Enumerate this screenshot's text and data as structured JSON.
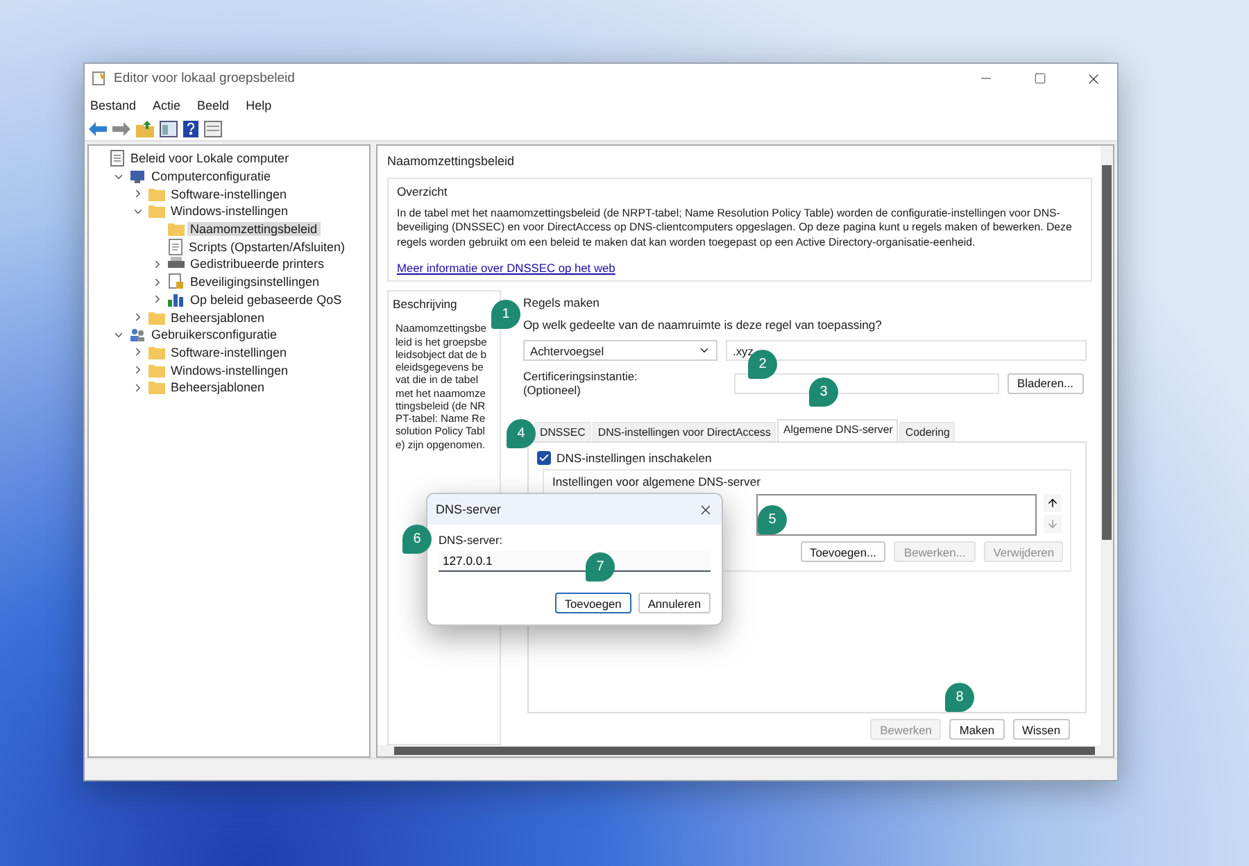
{
  "window": {
    "title": "Editor voor lokaal groepsbeleid"
  },
  "menu": [
    "Bestand",
    "Actie",
    "Beeld",
    "Help"
  ],
  "tree": [
    {
      "label": "Beleid voor Lokale computer",
      "kind": "policy",
      "selected": false,
      "children": [
        {
          "label": "Computerconfiguratie",
          "kind": "computer",
          "expanded": true,
          "selected": false,
          "children": [
            {
              "label": "Software-instellingen",
              "kind": "folder",
              "expanded": false,
              "selected": false
            },
            {
              "label": "Windows-instellingen",
              "kind": "folder",
              "expanded": true,
              "selected": false,
              "children": [
                {
                  "label": "Naamomzettingsbeleid",
                  "kind": "folder",
                  "selected": true
                },
                {
                  "label": "Scripts (Opstarten/Afsluiten)",
                  "kind": "script",
                  "selected": false
                },
                {
                  "label": "Gedistribueerde printers",
                  "kind": "printer",
                  "expanded": false,
                  "selected": false
                },
                {
                  "label": "Beveiligingsinstellingen",
                  "kind": "security",
                  "expanded": false,
                  "selected": false
                },
                {
                  "label": "Op beleid gebaseerde QoS",
                  "kind": "chart",
                  "expanded": false,
                  "selected": false
                }
              ]
            },
            {
              "label": "Beheersjablonen",
              "kind": "folder",
              "expanded": false,
              "selected": false
            }
          ]
        },
        {
          "label": "Gebruikersconfiguratie",
          "kind": "users",
          "expanded": true,
          "selected": false,
          "children": [
            {
              "label": "Software-instellingen",
              "kind": "folder",
              "expanded": false,
              "selected": false
            },
            {
              "label": "Windows-instellingen",
              "kind": "folder",
              "expanded": false,
              "selected": false
            },
            {
              "label": "Beheersjablonen",
              "kind": "folder",
              "expanded": false,
              "selected": false
            }
          ]
        }
      ]
    }
  ],
  "pane": {
    "title": "Naamomzettingsbeleid",
    "overview": {
      "heading": "Overzicht",
      "text": "In de tabel met het naamomzettingsbeleid (de NRPT-tabel; Name Resolution Policy Table) worden de configuratie-instellingen voor DNS-beveiliging (DNSSEC) en voor DirectAccess op DNS-clientcomputers opgeslagen. Op deze pagina kunt u regels maken of bewerken. Deze regels worden gebruikt om een beleid te maken dat kan worden toegepast op een Active Directory-organisatie-eenheid.",
      "link": "Meer informatie over DNSSEC op het web"
    },
    "description": {
      "heading": "Beschrijving",
      "text": "Naamomzettingsbeleid is het groepsbeleidsobject dat de beleidsgegevens bevat die in de tabel met het naamomzettingsbeleid (de NRPT-tabel: Name Resolution Policy Table) zijn opgenomen."
    },
    "rules": {
      "heading": "Regels maken",
      "question": "Op welk gedeelte van de naamruimte is deze regel van toepassing?",
      "type_select": "Achtervoegsel",
      "suffix_value": ".xyz",
      "ca_label": [
        "Certificeringsinstantie:",
        "(Optioneel)"
      ],
      "browse_button": "Bladeren...",
      "tabs": [
        {
          "label": "DNSSEC",
          "selected": false
        },
        {
          "label": "DNS-instellingen voor DirectAccess",
          "selected": false
        },
        {
          "label": "Algemene DNS-server",
          "selected": true
        },
        {
          "label": "Codering",
          "selected": false
        }
      ],
      "enable_checkbox": {
        "label": "DNS-instellingen inschakelen",
        "checked": true
      },
      "server_group": {
        "heading": "Instellingen voor algemene DNS-server",
        "buttons": [
          {
            "label": "Toevoegen...",
            "disabled": false
          },
          {
            "label": "Bewerken...",
            "disabled": true
          },
          {
            "label": "Verwijderen",
            "disabled": true
          }
        ]
      },
      "actions": [
        {
          "label": "Bewerken",
          "disabled": true
        },
        {
          "label": "Maken",
          "disabled": false
        },
        {
          "label": "Wissen",
          "disabled": false
        }
      ]
    }
  },
  "dialog": {
    "title": "DNS-server",
    "field_label": "DNS-server:",
    "field_value": "127.0.0.1",
    "buttons": [
      {
        "label": "Toevoegen",
        "default": true
      },
      {
        "label": "Annuleren",
        "default": false
      }
    ]
  },
  "callouts": [
    "1",
    "2",
    "3",
    "4",
    "5",
    "6",
    "7",
    "8"
  ]
}
